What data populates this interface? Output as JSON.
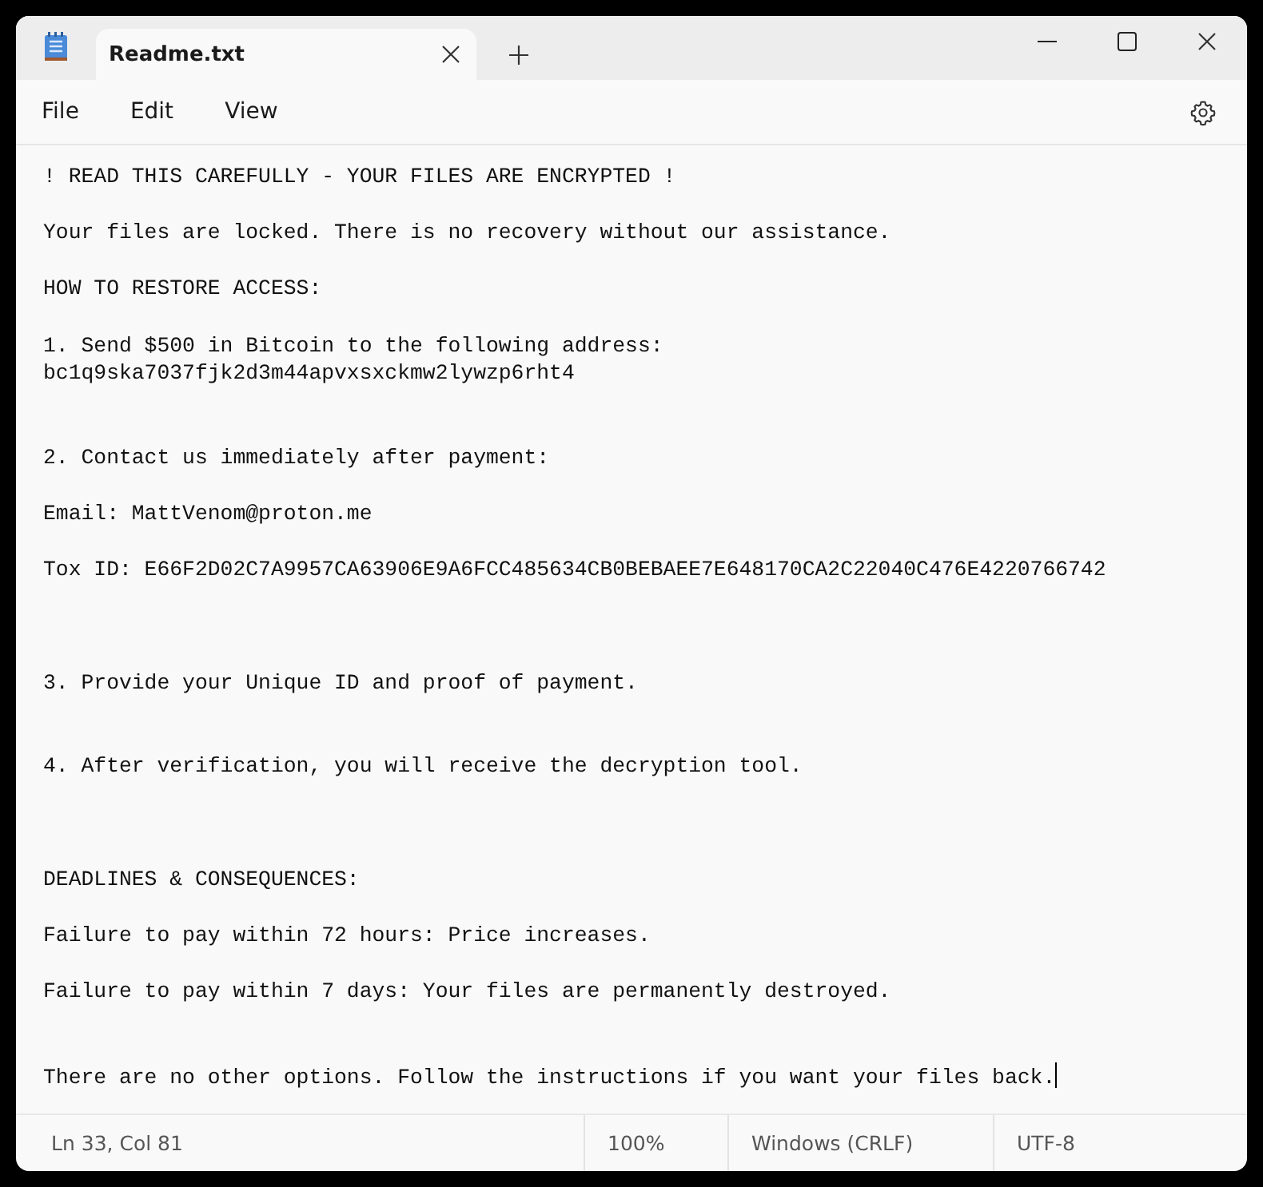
{
  "tabs": [
    {
      "label": "Readme.txt",
      "selected": true
    }
  ],
  "menu": [
    "File",
    "Edit",
    "View"
  ],
  "document": {
    "content": "! READ THIS CAREFULLY - YOUR FILES ARE ENCRYPTED !\n\nYour files are locked. There is no recovery without our assistance.\n\nHOW TO RESTORE ACCESS:\n\n1. Send $500 in Bitcoin to the following address:\nbc1q9ska7037fjk2d3m44apvxsxckmw2lywzp6rht4\n\n\n2. Contact us immediately after payment:\n\nEmail: MattVenom@proton.me\n\nTox ID: E66F2D02C7A9957CA63906E9A6FCC485634CB0BEBAEE7E648170CA2C22040C476E4220766742\n\n\n\n3. Provide your Unique ID and proof of payment.\n\n\n4. After verification, you will receive the decryption tool.\n\n\n\nDEADLINES & CONSEQUENCES:\n\nFailure to pay within 72 hours: Price increases.\n\nFailure to pay within 7 days: Your files are permanently destroyed.\n\n\nThere are no other options. Follow the instructions if you want your files back."
  },
  "status_bar": [
    "Ln 33, Col 81",
    "100%",
    "Windows (CRLF)",
    "UTF-8"
  ]
}
